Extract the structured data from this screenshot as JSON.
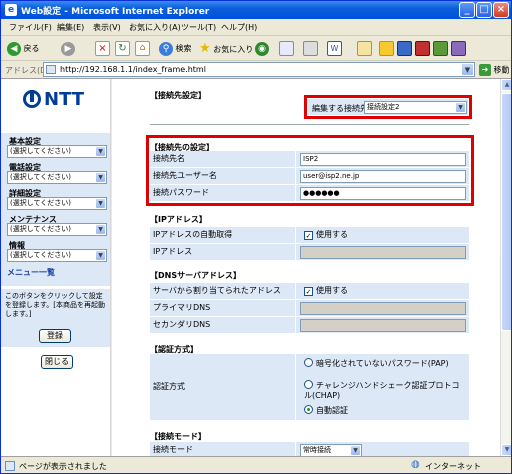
{
  "window": {
    "title": "Web設定 - Microsoft Internet Explorer"
  },
  "menu": [
    "ファイル(F)",
    "編集(E)",
    "表示(V)",
    "お気に入り(A)",
    "ツール(T)",
    "ヘルプ(H)"
  ],
  "toolbar": {
    "back": "戻る",
    "search": "検索",
    "favorites": "お気に入り"
  },
  "address": {
    "label": "アドレス(D)",
    "url": "http://192.168.1.1/index_frame.html",
    "go": "移動"
  },
  "logo": "NTT",
  "nav": [
    {
      "label": "基本設定",
      "value": "(選択してください)"
    },
    {
      "label": "電話設定",
      "value": "(選択してください)"
    },
    {
      "label": "詳細設定",
      "value": "(選択してください)"
    },
    {
      "label": "メンテナンス",
      "value": "(選択してください)"
    },
    {
      "label": "情報",
      "value": "(選択してください)"
    }
  ],
  "menu_list_link": "メニュー一覧",
  "notice": "このボタンをクリックして設定を登録します。[本商品を再起動します。]",
  "register_button": "登録",
  "close_button": "閉じる",
  "main": {
    "s_connect": "【接続先設定】",
    "edit_label": "編集する接続先",
    "edit_value": "接続設定2",
    "s_conn_settings": "【接続先の設定】",
    "conn_name_k": "接続先名",
    "conn_name_v": "ISP2",
    "conn_user_k": "接続先ユーザー名",
    "conn_user_v": "user@isp2.ne.jp",
    "conn_pass_k": "接続パスワード",
    "conn_pass_v": "●●●●●●",
    "s_ip": "【IPアドレス】",
    "ip_auto_k": "IPアドレスの自動取得",
    "ip_auto_v": "使用する",
    "ip_k": "IPアドレス",
    "s_dns": "【DNSサーバアドレス】",
    "dns_auto_k": "サーバから割り当てられたアドレス",
    "dns_auto_v": "使用する",
    "dns1_k": "プライマリDNS",
    "dns2_k": "セカンダリDNS",
    "s_auth": "【認証方式】",
    "auth_k": "認証方式",
    "auth_pap": "暗号化されていないパスワード(PAP)",
    "auth_chap": "チャレンジハンドシェーク認証プロトコル(CHAP)",
    "auth_auto": "自動認証",
    "s_mode": "【接続モード】",
    "mode_k": "接続モード",
    "mode_v": "常時接続"
  },
  "status": {
    "text": "ページが表示されました",
    "zone": "インターネット"
  }
}
